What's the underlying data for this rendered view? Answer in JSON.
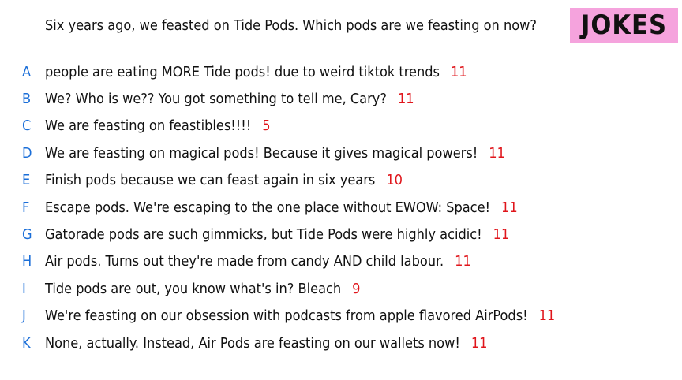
{
  "question": "Six years ago, we feasted on Tide Pods. Which pods are we feasting on now?",
  "badge": "JOKES",
  "colors": {
    "badge_background": "#f5a3dd",
    "letter": "#1a6ed8",
    "score": "#e0151b",
    "text": "#111111"
  },
  "answers": [
    {
      "letter": "A",
      "text": "people are eating MORE Tide pods! due to weird tiktok trends",
      "score": "11"
    },
    {
      "letter": "B",
      "text": "We? Who is we?? You got something to tell me, Cary?",
      "score": "11"
    },
    {
      "letter": "C",
      "text": "We are feasting on feastibles!!!!",
      "score": "5"
    },
    {
      "letter": "D",
      "text": "We are feasting on magical pods! Because it gives magical powers!",
      "score": "11"
    },
    {
      "letter": "E",
      "text": "Finish pods because we can feast again in six years",
      "score": "10"
    },
    {
      "letter": "F",
      "text": "Escape pods. We're escaping to the one place without EWOW: Space!",
      "score": "11"
    },
    {
      "letter": "G",
      "text": "Gatorade pods are such gimmicks, but Tide Pods were highly acidic!",
      "score": "11"
    },
    {
      "letter": "H",
      "text": "Air pods. Turns out they're made from candy AND child labour.",
      "score": "11"
    },
    {
      "letter": "I",
      "text": "Tide pods are out, you know what's in? Bleach",
      "score": "9"
    },
    {
      "letter": "J",
      "text": "We're feasting on our obsession with podcasts from apple flavored AirPods!",
      "score": "11"
    },
    {
      "letter": "K",
      "text": "None, actually. Instead, Air Pods are feasting on our wallets now!",
      "score": "11"
    }
  ]
}
